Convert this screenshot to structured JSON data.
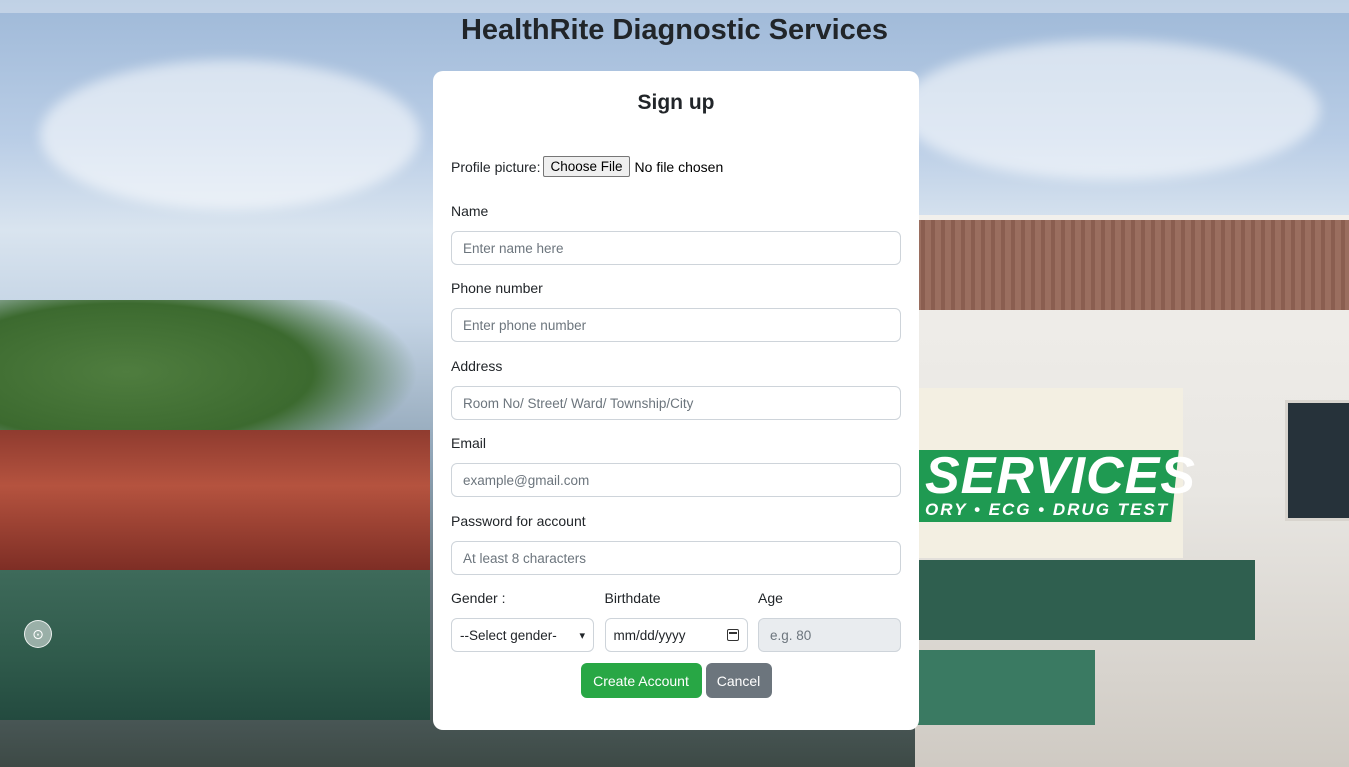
{
  "site": {
    "title": "HealthRite Diagnostic Services"
  },
  "background": {
    "sign_text": "SERVICES",
    "sign_subtext": "ORY • ECG • DRUG TEST"
  },
  "form": {
    "title": "Sign up",
    "profile_picture": {
      "label": "Profile picture:",
      "button_label": "Choose File",
      "status": "No file chosen"
    },
    "name": {
      "label": "Name",
      "placeholder": "Enter name here"
    },
    "phone": {
      "label": "Phone number",
      "placeholder": "Enter phone number"
    },
    "address": {
      "label": "Address",
      "placeholder": "Room No/ Street/ Ward/ Township/City"
    },
    "email": {
      "label": "Email",
      "placeholder": "example@gmail.com"
    },
    "password": {
      "label": "Password for account",
      "placeholder": "At least 8 characters"
    },
    "gender": {
      "label": "Gender :",
      "selected": "--Select gender-"
    },
    "birthdate": {
      "label": "Birthdate",
      "placeholder": "mm/dd/yyyy"
    },
    "age": {
      "label": "Age",
      "placeholder": "e.g. 80"
    },
    "buttons": {
      "create": "Create Account",
      "cancel": "Cancel"
    }
  },
  "colors": {
    "primary_green": "#28a745",
    "secondary_gray": "#6c757d",
    "card_bg": "#ffffff"
  }
}
